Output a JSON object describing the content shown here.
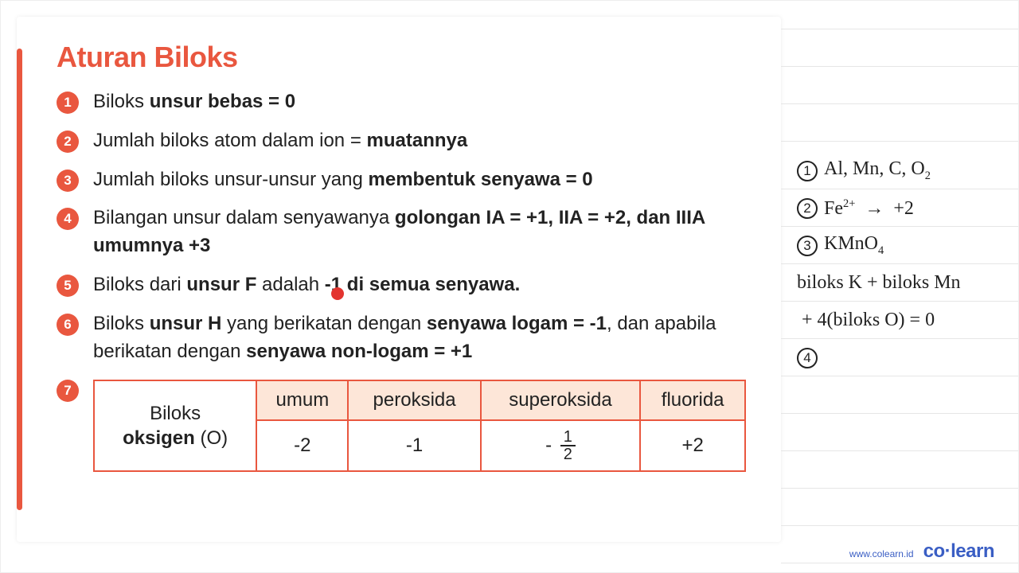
{
  "slide": {
    "title": "Aturan Biloks",
    "rules": [
      {
        "n": "1",
        "html": "Biloks <b>unsur bebas = 0</b>"
      },
      {
        "n": "2",
        "html": "Jumlah biloks atom dalam ion = <b>muatannya</b>"
      },
      {
        "n": "3",
        "html": "Jumlah biloks unsur-unsur yang <b>membentuk senyawa = 0</b>"
      },
      {
        "n": "4",
        "html": "Bilangan unsur dalam senyawanya <b>golongan IA = +1, IIA = +2, dan IIIA umumnya +3</b>"
      },
      {
        "n": "5",
        "html": "Biloks dari <b>unsur F</b> adalah <b>-1 di semua senyawa.</b>"
      },
      {
        "n": "6",
        "html": "Biloks <b>unsur H</b> yang berikatan dengan <b>senyawa logam = -1</b>, dan apabila berikatan dengan <b>senyawa non-logam = +1</b>"
      }
    ],
    "rule7_n": "7",
    "table": {
      "row_label_html": "Biloks<br><b>oksigen</b> (O)",
      "headers": [
        "umum",
        "peroksida",
        "superoksida",
        "fluorida"
      ],
      "values": [
        "-2",
        "-1",
        "-1/2",
        "+2"
      ]
    }
  },
  "notes": {
    "lines": [
      {
        "circ": "1",
        "html": "Al, Mn, C, O<span class='sub'>2</span>"
      },
      {
        "circ": "2",
        "html": "Fe<span class='sup'>2+</span> &nbsp;→&nbsp; +2"
      },
      {
        "circ": "3",
        "html": "KMnO<span class='sub'>4</span>"
      },
      {
        "circ": "",
        "html": "biloks K + biloks Mn"
      },
      {
        "circ": "",
        "html": "&nbsp;+ 4(biloks O) = 0"
      },
      {
        "circ": "4",
        "html": ""
      }
    ]
  },
  "footer": {
    "url": "www.colearn.id",
    "brand_pre": "co",
    "brand_dot": "·",
    "brand_post": "learn"
  }
}
